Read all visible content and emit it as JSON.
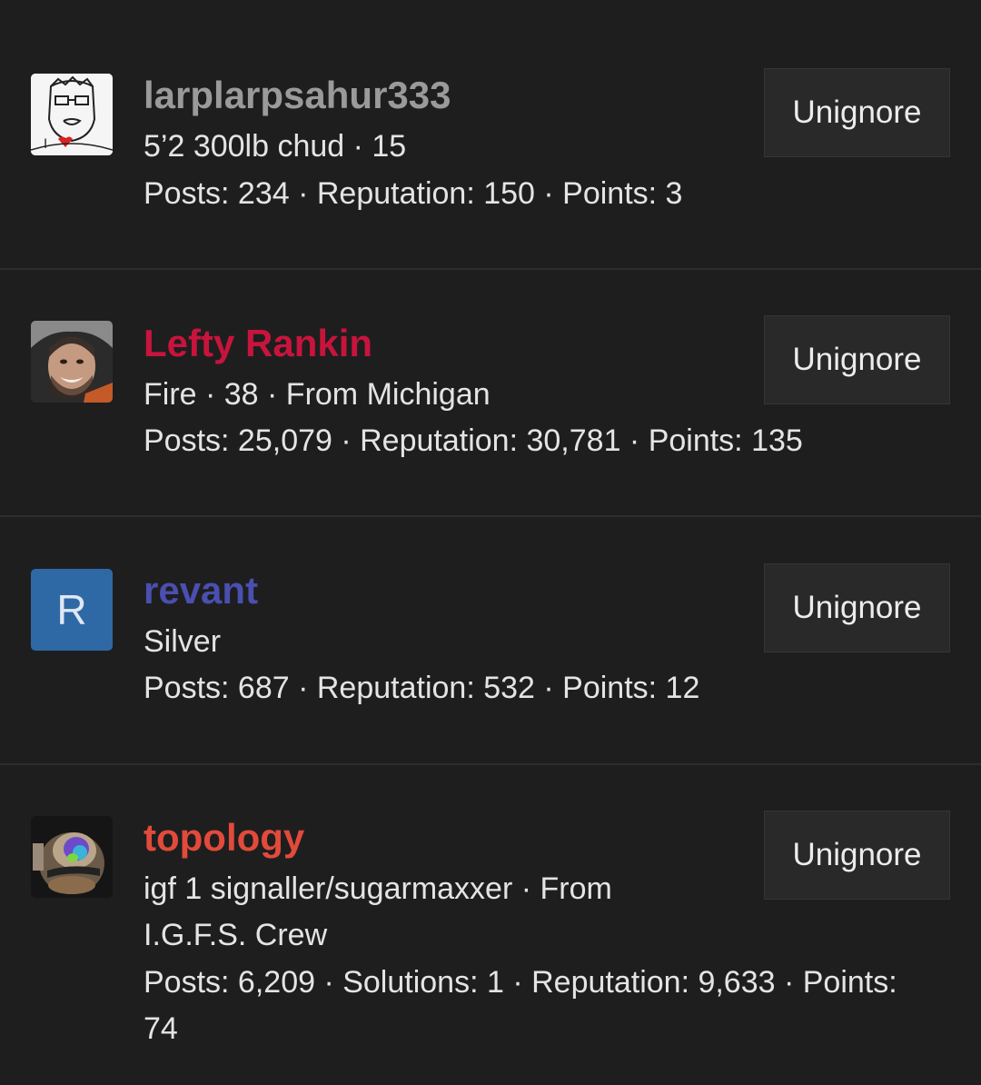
{
  "members": [
    {
      "name": "larplarpsahur333",
      "name_color": "#9a9a9a",
      "avatar_icon": "sketch-face-avatar",
      "info": [
        "5’2 300lb chud · 15"
      ],
      "stats": [
        "Posts: 234 · Reputation: 150 · Points: 3"
      ],
      "button": "Unignore"
    },
    {
      "name": "Lefty Rankin",
      "name_color": "#c8143c",
      "avatar_icon": "photo-avatar",
      "info": [
        "Fire · 38 · From Michigan"
      ],
      "stats": [
        "Posts: 25,079 · Reputation: 30,781 · Points: 135"
      ],
      "button": "Unignore"
    },
    {
      "name": "revant",
      "name_color": "#4a4fb0",
      "avatar_letter": "R",
      "info": [
        "Silver"
      ],
      "stats": [
        "Posts: 687 · Reputation: 532 · Points: 12"
      ],
      "button": "Unignore"
    },
    {
      "name": "topology",
      "name_color": "#e24a3a",
      "avatar_icon": "brain-render-avatar",
      "info": [
        "igf 1 signaller/sugarmaxxer · From",
        "I.G.F.S. Crew"
      ],
      "stats": [
        "Posts: 6,209 · Solutions: 1 · Reputation: 9,633 · Points:",
        "74"
      ],
      "button": "Unignore"
    }
  ]
}
